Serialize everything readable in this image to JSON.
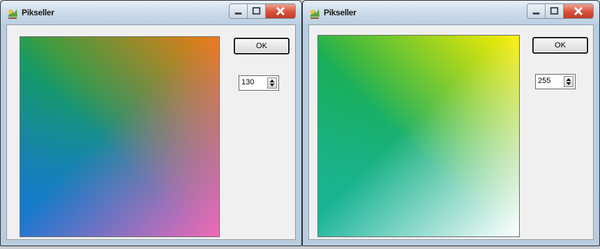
{
  "windows": [
    {
      "title": "Pikseller",
      "ok_label": "OK",
      "spinner_value": "130",
      "icons": {
        "app": "app-icon",
        "minimize": "minimize-icon",
        "maximize": "maximize-icon",
        "close": "close-icon",
        "spinner": "up-down-arrows-icon"
      },
      "gradient_colors": {
        "top_left": "#17a34a",
        "top_right": "#f07a14",
        "bottom_left": "#1478d2",
        "bottom_right": "#f06ab3"
      }
    },
    {
      "title": "Pikseller",
      "ok_label": "OK",
      "spinner_value": "255",
      "icons": {
        "app": "app-icon",
        "minimize": "minimize-icon",
        "maximize": "maximize-icon",
        "close": "close-icon",
        "spinner": "up-down-arrows-icon"
      },
      "gradient_colors": {
        "top_left": "#18ad4a",
        "top_right": "#ffee00",
        "bottom_left": "#1ab499",
        "bottom_right": "#ffffff"
      }
    }
  ]
}
